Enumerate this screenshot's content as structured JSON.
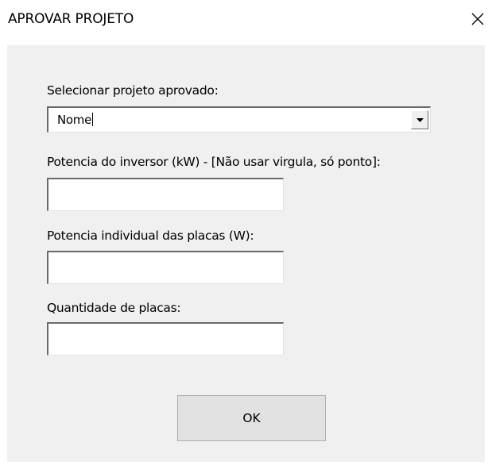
{
  "window": {
    "title": "APROVAR PROJETO",
    "close_icon": "close-icon"
  },
  "form": {
    "project_select": {
      "label": "Selecionar projeto aprovado:",
      "value": "Nome",
      "arrow_icon": "dropdown-arrow-icon"
    },
    "inverter_power": {
      "label": "Potencia do inversor (kW) - [Não usar virgula, só ponto]:",
      "value": ""
    },
    "panel_power": {
      "label": "Potencia individual das placas (W):",
      "value": ""
    },
    "panel_quantity": {
      "label": "Quantidade de placas:",
      "value": ""
    },
    "ok_label": "OK"
  },
  "colors": {
    "client_background": "#f0f0f0",
    "button_face": "#e1e1e1",
    "button_border": "#adadad",
    "field_shadow": "#696969"
  }
}
